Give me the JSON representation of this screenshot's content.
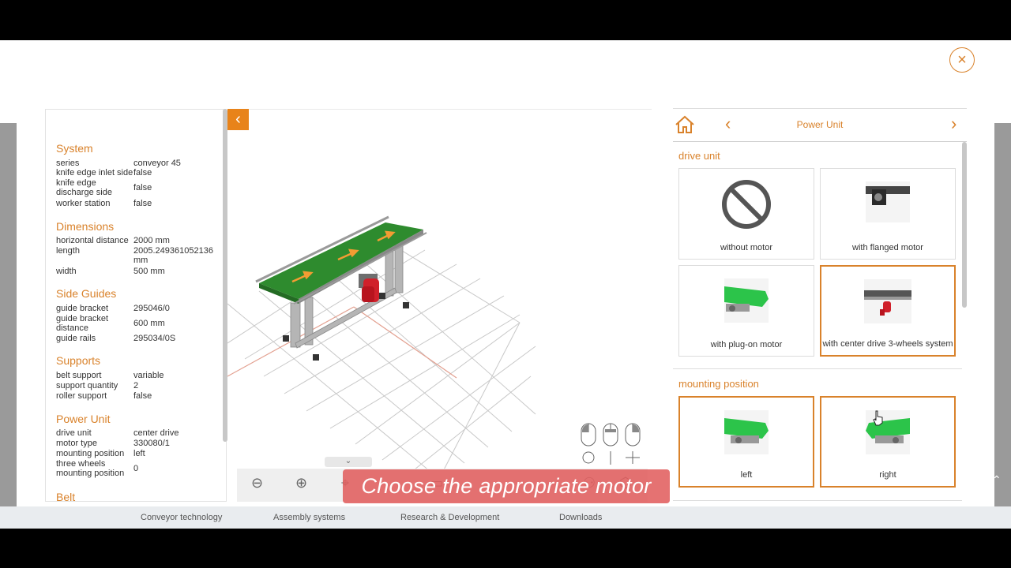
{
  "footer": {
    "links": [
      "Conveyor technology",
      "Assembly systems",
      "Research & Development",
      "Downloads"
    ]
  },
  "modal": {
    "close_label": "×"
  },
  "summary": {
    "sections": [
      {
        "title": "System",
        "rows": [
          {
            "k": "series",
            "v": "conveyor 45"
          },
          {
            "k": "knife edge inlet side",
            "v": "false"
          },
          {
            "k": "knife edge discharge side",
            "v": "false"
          },
          {
            "k": "worker station",
            "v": "false"
          }
        ]
      },
      {
        "title": "Dimensions",
        "rows": [
          {
            "k": "horizontal distance",
            "v": "2000 mm"
          },
          {
            "k": "length",
            "v": "2005.249361052136 mm"
          },
          {
            "k": "width",
            "v": "500 mm"
          }
        ]
      },
      {
        "title": "Side Guides",
        "rows": [
          {
            "k": "guide bracket",
            "v": "295046/0"
          },
          {
            "k": "guide bracket distance",
            "v": "600 mm"
          },
          {
            "k": "guide rails",
            "v": "295034/0S"
          }
        ]
      },
      {
        "title": "Supports",
        "rows": [
          {
            "k": "belt support",
            "v": "variable"
          },
          {
            "k": "support quantity",
            "v": "2"
          },
          {
            "k": "roller support",
            "v": "false"
          }
        ]
      },
      {
        "title": "Power Unit",
        "rows": [
          {
            "k": "drive unit",
            "v": "center drive"
          },
          {
            "k": "motor type",
            "v": "330080/1"
          },
          {
            "k": "mounting position",
            "v": "left"
          },
          {
            "k": "three wheels mounting position",
            "v": "0"
          }
        ]
      },
      {
        "title": "Belt",
        "rows": []
      }
    ]
  },
  "viewer": {
    "collapse_icon": "chevron-left-icon",
    "expand_icon": "double-chevron-down-icon",
    "caption": "Choose the appropriate motor"
  },
  "config": {
    "nav_title": "Power Unit",
    "groups": [
      {
        "title": "drive unit",
        "options": [
          {
            "label": "without motor",
            "selected": false
          },
          {
            "label": "with flanged motor",
            "selected": false
          },
          {
            "label": "with plug-on motor",
            "selected": false
          },
          {
            "label": "with center drive 3-wheels system",
            "selected": true
          }
        ]
      },
      {
        "title": "mounting position",
        "options": [
          {
            "label": "left",
            "selected": true
          },
          {
            "label": "right",
            "selected": true
          }
        ]
      }
    ]
  },
  "colors": {
    "accent": "#d9822b",
    "belt": "#2e8b2e",
    "motor": "#d0202a",
    "caption_bg": "#e15f5f"
  }
}
